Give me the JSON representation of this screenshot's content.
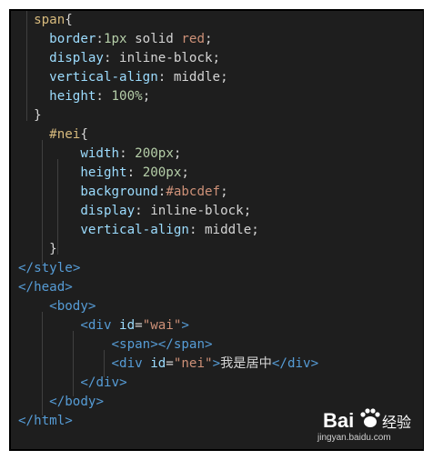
{
  "lines": [
    {
      "indent": "  ",
      "tokens": [
        {
          "t": "span",
          "c": "sel"
        },
        {
          "t": "{",
          "c": "txt"
        }
      ]
    },
    {
      "indent": "    ",
      "tokens": [
        {
          "t": "border",
          "c": "prop"
        },
        {
          "t": ":",
          "c": "txt"
        },
        {
          "t": "1px",
          "c": "num"
        },
        {
          "t": " solid ",
          "c": "txt"
        },
        {
          "t": "red",
          "c": "str"
        },
        {
          "t": ";",
          "c": "txt"
        }
      ]
    },
    {
      "indent": "    ",
      "tokens": [
        {
          "t": "display",
          "c": "prop"
        },
        {
          "t": ": inline-block;",
          "c": "txt"
        }
      ]
    },
    {
      "indent": "    ",
      "tokens": [
        {
          "t": "vertical-align",
          "c": "prop"
        },
        {
          "t": ": middle;",
          "c": "txt"
        }
      ]
    },
    {
      "indent": "    ",
      "tokens": [
        {
          "t": "height",
          "c": "prop"
        },
        {
          "t": ": ",
          "c": "txt"
        },
        {
          "t": "100%",
          "c": "num"
        },
        {
          "t": ";",
          "c": "txt"
        }
      ]
    },
    {
      "indent": "  ",
      "tokens": [
        {
          "t": "}",
          "c": "txt"
        }
      ]
    },
    {
      "indent": "    ",
      "tokens": [
        {
          "t": "#nei",
          "c": "sel"
        },
        {
          "t": "{",
          "c": "txt"
        }
      ]
    },
    {
      "indent": "        ",
      "tokens": [
        {
          "t": "width",
          "c": "prop"
        },
        {
          "t": ": ",
          "c": "txt"
        },
        {
          "t": "200px",
          "c": "num"
        },
        {
          "t": ";",
          "c": "txt"
        }
      ]
    },
    {
      "indent": "        ",
      "tokens": [
        {
          "t": "height",
          "c": "prop"
        },
        {
          "t": ": ",
          "c": "txt"
        },
        {
          "t": "200px",
          "c": "num"
        },
        {
          "t": ";",
          "c": "txt"
        }
      ]
    },
    {
      "indent": "        ",
      "tokens": [
        {
          "t": "background",
          "c": "prop"
        },
        {
          "t": ":",
          "c": "txt"
        },
        {
          "t": "#abcdef",
          "c": "str"
        },
        {
          "t": ";",
          "c": "txt"
        }
      ]
    },
    {
      "indent": "        ",
      "tokens": [
        {
          "t": "display",
          "c": "prop"
        },
        {
          "t": ": inline-block;",
          "c": "txt"
        }
      ]
    },
    {
      "indent": "        ",
      "tokens": [
        {
          "t": "vertical-align",
          "c": "prop"
        },
        {
          "t": ": middle;",
          "c": "txt"
        }
      ]
    },
    {
      "indent": "    ",
      "tokens": [
        {
          "t": "}",
          "c": "txt"
        }
      ]
    },
    {
      "indent": "",
      "tokens": [
        {
          "t": "</",
          "c": "tag"
        },
        {
          "t": "style",
          "c": "tag"
        },
        {
          "t": ">",
          "c": "tag"
        }
      ]
    },
    {
      "indent": "",
      "tokens": [
        {
          "t": "</",
          "c": "tag"
        },
        {
          "t": "head",
          "c": "tag"
        },
        {
          "t": ">",
          "c": "tag"
        }
      ]
    },
    {
      "indent": "    ",
      "tokens": [
        {
          "t": "<",
          "c": "tag"
        },
        {
          "t": "body",
          "c": "tag"
        },
        {
          "t": ">",
          "c": "tag"
        }
      ]
    },
    {
      "indent": "        ",
      "tokens": [
        {
          "t": "<",
          "c": "tag"
        },
        {
          "t": "div",
          "c": "tag"
        },
        {
          "t": " id",
          "c": "prop"
        },
        {
          "t": "=",
          "c": "txt"
        },
        {
          "t": "\"wai\"",
          "c": "str"
        },
        {
          "t": ">",
          "c": "tag"
        }
      ]
    },
    {
      "indent": "            ",
      "tokens": [
        {
          "t": "<",
          "c": "tag"
        },
        {
          "t": "span",
          "c": "tag"
        },
        {
          "t": "></",
          "c": "tag"
        },
        {
          "t": "span",
          "c": "tag"
        },
        {
          "t": ">",
          "c": "tag"
        }
      ]
    },
    {
      "indent": "            ",
      "tokens": [
        {
          "t": "<",
          "c": "tag"
        },
        {
          "t": "div",
          "c": "tag"
        },
        {
          "t": " id",
          "c": "prop"
        },
        {
          "t": "=",
          "c": "txt"
        },
        {
          "t": "\"nei\"",
          "c": "str"
        },
        {
          "t": ">",
          "c": "tag"
        },
        {
          "t": "我是居中",
          "c": "txt"
        },
        {
          "t": "</",
          "c": "tag"
        },
        {
          "t": "div",
          "c": "tag"
        },
        {
          "t": ">",
          "c": "tag"
        }
      ]
    },
    {
      "indent": "        ",
      "tokens": [
        {
          "t": "</",
          "c": "tag"
        },
        {
          "t": "div",
          "c": "tag"
        },
        {
          "t": ">",
          "c": "tag"
        }
      ]
    },
    {
      "indent": "    ",
      "tokens": [
        {
          "t": "</",
          "c": "tag"
        },
        {
          "t": "body",
          "c": "tag"
        },
        {
          "t": ">",
          "c": "tag"
        }
      ]
    },
    {
      "indent": "",
      "tokens": [
        {
          "t": "</",
          "c": "tag"
        },
        {
          "t": "html",
          "c": "tag"
        },
        {
          "t": ">",
          "c": "tag"
        }
      ]
    }
  ],
  "watermark": {
    "brand_left": "Bai",
    "brand_right": "经验",
    "url": "jingyan.baidu.com"
  },
  "colors": {
    "editor_background": "#1e1e1e",
    "tag": "#569cd6",
    "selector": "#d7ba7d",
    "property": "#9cdcfe",
    "number": "#b5cea8",
    "string": "#ce9178",
    "text": "#d4d4d4"
  }
}
